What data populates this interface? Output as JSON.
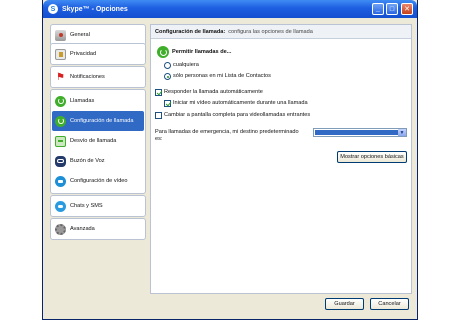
{
  "window": {
    "title": "Skype™ - Opciones"
  },
  "sidebar": {
    "groups": [
      {
        "items": [
          {
            "label": "General",
            "icon": "person-icon"
          }
        ]
      },
      {
        "items": [
          {
            "label": "Privacidad",
            "icon": "privacy-icon"
          }
        ]
      },
      {
        "items": [
          {
            "label": "Notificaciones",
            "icon": "flag-icon"
          }
        ]
      },
      {
        "items": [
          {
            "label": "Llamadas",
            "icon": "phone-icon"
          },
          {
            "label": "Configuración de llamada",
            "icon": "phone-icon",
            "selected": true
          },
          {
            "label": "Desvío de llamada",
            "icon": "call-forward-icon"
          },
          {
            "label": "Buzón de Voz",
            "icon": "voicemail-icon"
          },
          {
            "label": "Configuración de vídeo",
            "icon": "video-icon"
          }
        ]
      },
      {
        "items": [
          {
            "label": "Chats y SMS",
            "icon": "chat-icon"
          }
        ]
      },
      {
        "items": [
          {
            "label": "Avanzada",
            "icon": "gear-icon"
          }
        ]
      }
    ]
  },
  "content": {
    "header_title": "Configuración de llamada:",
    "header_subtitle": "configura las opciones de llamada",
    "allow_calls_label": "Permitir llamadas de...",
    "radio_anyone": "cualquiera",
    "radio_contacts": "sólo personas en mi Lista de Contactos",
    "selected_radio": "contacts",
    "auto_answer_label": "Responder la llamada automáticamente",
    "auto_answer_checked": true,
    "auto_video_label": "Iniciar mi vídeo automáticamente durante una llamada",
    "auto_video_checked": true,
    "fullscreen_label": "Cambiar a pantalla completa para videollamadas entrantes",
    "fullscreen_checked": false,
    "emergency_label_line1": "Para llamadas de emergencia, mi destino predeterminado",
    "emergency_label_line2": "es:",
    "emergency_select_value": "",
    "advanced_button": "Mostrar opciones básicas"
  },
  "footer": {
    "save_button": "Guardar",
    "cancel_button": "Cancelar"
  },
  "colors": {
    "titlebar": "#1d5ee0",
    "selection": "#316ac5",
    "window_bg": "#ece9d8"
  }
}
